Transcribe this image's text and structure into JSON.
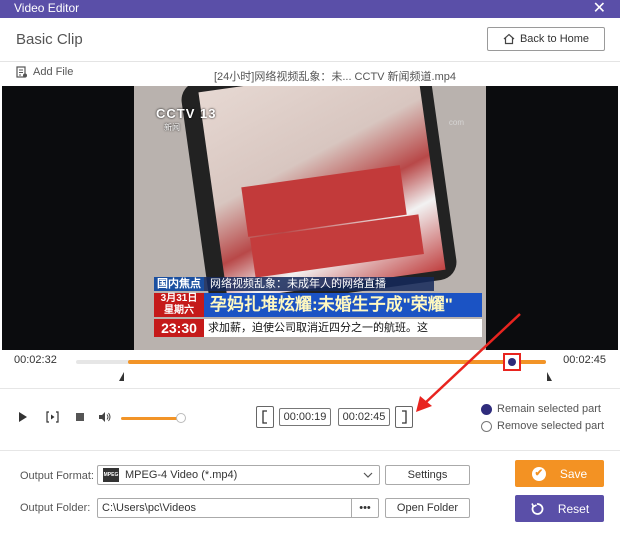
{
  "window": {
    "title": "Video Editor",
    "close_label": "✕"
  },
  "header": {
    "title": "Basic Clip",
    "back_label": "Back to Home"
  },
  "toolbar": {
    "add_file_label": "Add File",
    "filename": "[24小时]网络视频乱象：未... CCTV 新闻频道.mp4"
  },
  "video": {
    "channel_logo": "CCTV 13",
    "channel_sub": "新闻",
    "watermark": "com",
    "ticker_tag": "国内焦点",
    "ticker_text": "网络视频乱象：未成年人的网络直播",
    "date_line1": "3月31日",
    "date_line2": "星期六",
    "headline": "孕妈扎堆炫耀:未婚生子成\"荣耀\"",
    "clock": "23:30",
    "scroll_text": "求加薪，迫使公司取消近四分之一的航班。这"
  },
  "timeline": {
    "start_time": "00:02:32",
    "end_time": "00:02:45",
    "selection_start_fraction": 0.11,
    "playhead_fraction": 0.93
  },
  "controls": {
    "clip_start": "00:00:19",
    "clip_end": "00:02:45",
    "volume_fraction": 0.9,
    "remain_label": "Remain selected part",
    "remove_label": "Remove selected part",
    "selected_mode": "remain"
  },
  "output": {
    "format_label": "Output Format:",
    "format_value": "MPEG-4 Video (*.mp4)",
    "format_icon_text": "MPEG",
    "settings_label": "Settings",
    "folder_label": "Output Folder:",
    "folder_value": "C:\\Users\\pc\\Videos",
    "browse_label": "•••",
    "open_folder_label": "Open Folder",
    "save_label": "Save",
    "reset_label": "Reset"
  },
  "colors": {
    "accent_purple": "#5a4fa8",
    "accent_orange": "#f39223",
    "annotation_red": "#e8241f"
  },
  "icons": [
    "home-icon",
    "add-file-icon",
    "play-icon",
    "step-frame-icon",
    "stop-icon",
    "volume-icon",
    "chevron-down-icon",
    "save-check-icon",
    "reset-icon"
  ]
}
